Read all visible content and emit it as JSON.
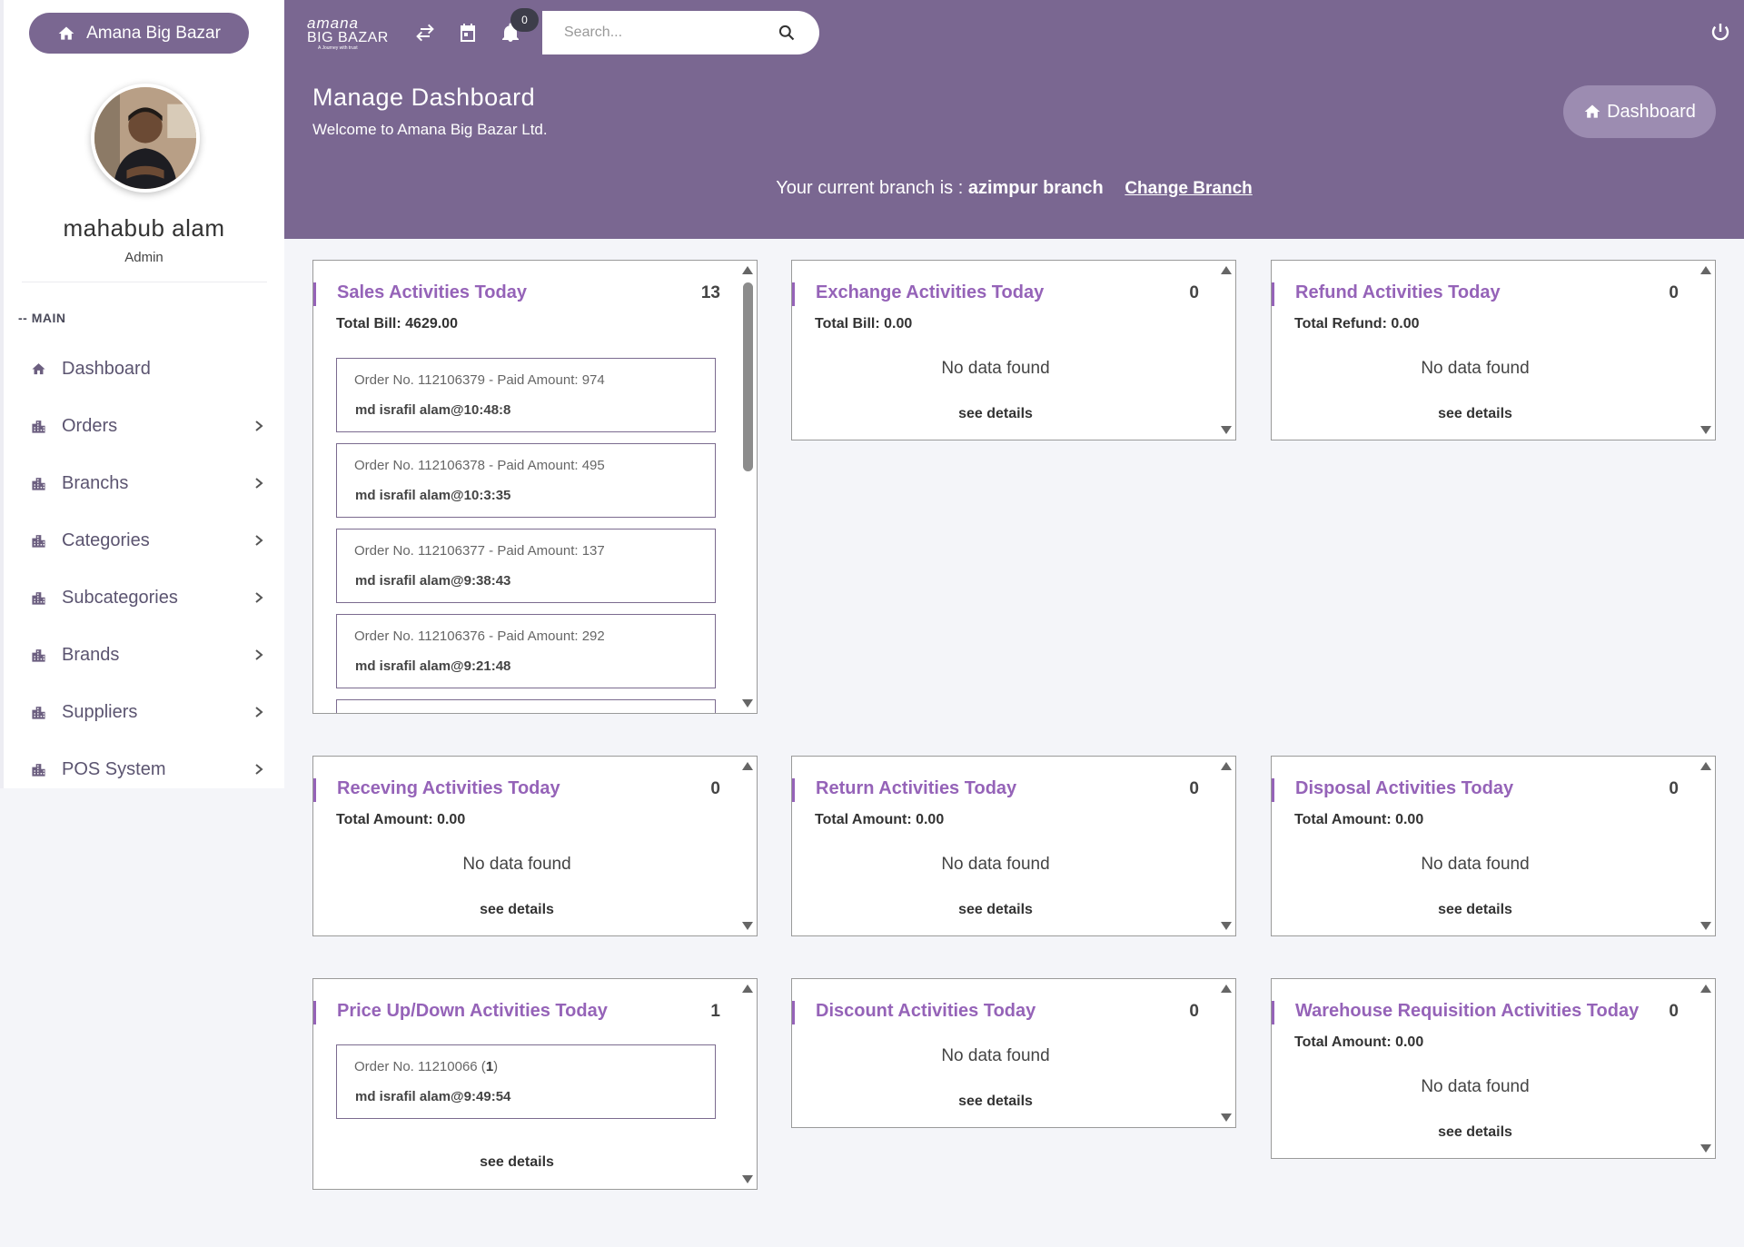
{
  "sidebar": {
    "brand_button": "Amana Big Bazar",
    "user_name": "mahabub alam",
    "user_role": "Admin",
    "section_label": "-- MAIN",
    "items": [
      {
        "label": "Dashboard",
        "icon": "home-icon"
      },
      {
        "label": "Orders",
        "icon": "building-icon"
      },
      {
        "label": "Branchs",
        "icon": "building-icon"
      },
      {
        "label": "Categories",
        "icon": "building-icon"
      },
      {
        "label": "Subcategories",
        "icon": "building-icon"
      },
      {
        "label": "Brands",
        "icon": "building-icon"
      },
      {
        "label": "Suppliers",
        "icon": "building-icon"
      },
      {
        "label": "POS System",
        "icon": "building-icon"
      }
    ]
  },
  "topbar": {
    "logo_line1": "amana",
    "logo_line2": "BIG BAZAR",
    "logo_tagline": "A Journey with trust",
    "notification_count": "0",
    "search_placeholder": "Search..."
  },
  "header": {
    "title": "Manage Dashboard",
    "subtitle": "Welcome to Amana Big Bazar Ltd.",
    "dashboard_button": "Dashboard",
    "branch_prefix": "Your current branch is : ",
    "branch_name": "azimpur branch",
    "change_branch": "Change Branch"
  },
  "cards": {
    "sales": {
      "title": "Sales Activities Today",
      "count": "13",
      "total": "Total Bill: 4629.00",
      "orders": [
        {
          "line": "Order No. 112106379 - Paid Amount: 974",
          "user": "md israfil alam@10:48:8"
        },
        {
          "line": "Order No. 112106378 - Paid Amount: 495",
          "user": "md israfil alam@10:3:35"
        },
        {
          "line": "Order No. 112106377 - Paid Amount: 137",
          "user": "md israfil alam@9:38:43"
        },
        {
          "line": "Order No. 112106376 - Paid Amount: 292",
          "user": "md israfil alam@9:21:48"
        }
      ]
    },
    "exchange": {
      "title": "Exchange Activities Today",
      "count": "0",
      "total": "Total Bill: 0.00",
      "no_data": "No data found",
      "see_details": "see details"
    },
    "refund": {
      "title": "Refund Activities Today",
      "count": "0",
      "total": "Total Refund: 0.00",
      "no_data": "No data found",
      "see_details": "see details"
    },
    "receiving": {
      "title": "Receving Activities Today",
      "count": "0",
      "total": "Total Amount: 0.00",
      "no_data": "No data found",
      "see_details": "see details"
    },
    "return": {
      "title": "Return Activities Today",
      "count": "0",
      "total": "Total Amount: 0.00",
      "no_data": "No data found",
      "see_details": "see details"
    },
    "disposal": {
      "title": "Disposal Activities Today",
      "count": "0",
      "total": "Total Amount: 0.00",
      "no_data": "No data found",
      "see_details": "see details"
    },
    "price": {
      "title": "Price Up/Down Activities Today",
      "count": "1",
      "order_prefix": "Order No. 11210066 (",
      "order_qty": "1",
      "order_suffix": ")",
      "user": "md israfil alam@9:49:54",
      "see_details": "see details"
    },
    "discount": {
      "title": "Discount Activities Today",
      "count": "0",
      "no_data": "No data found",
      "see_details": "see details"
    },
    "warehouse": {
      "title": "Warehouse Requisition Activities Today",
      "count": "0",
      "total": "Total Amount: 0.00",
      "no_data": "No data found",
      "see_details": "see details"
    }
  },
  "colors": {
    "brand": "#7a6791",
    "accent": "#9563b8",
    "background": "#f4f5f9"
  }
}
